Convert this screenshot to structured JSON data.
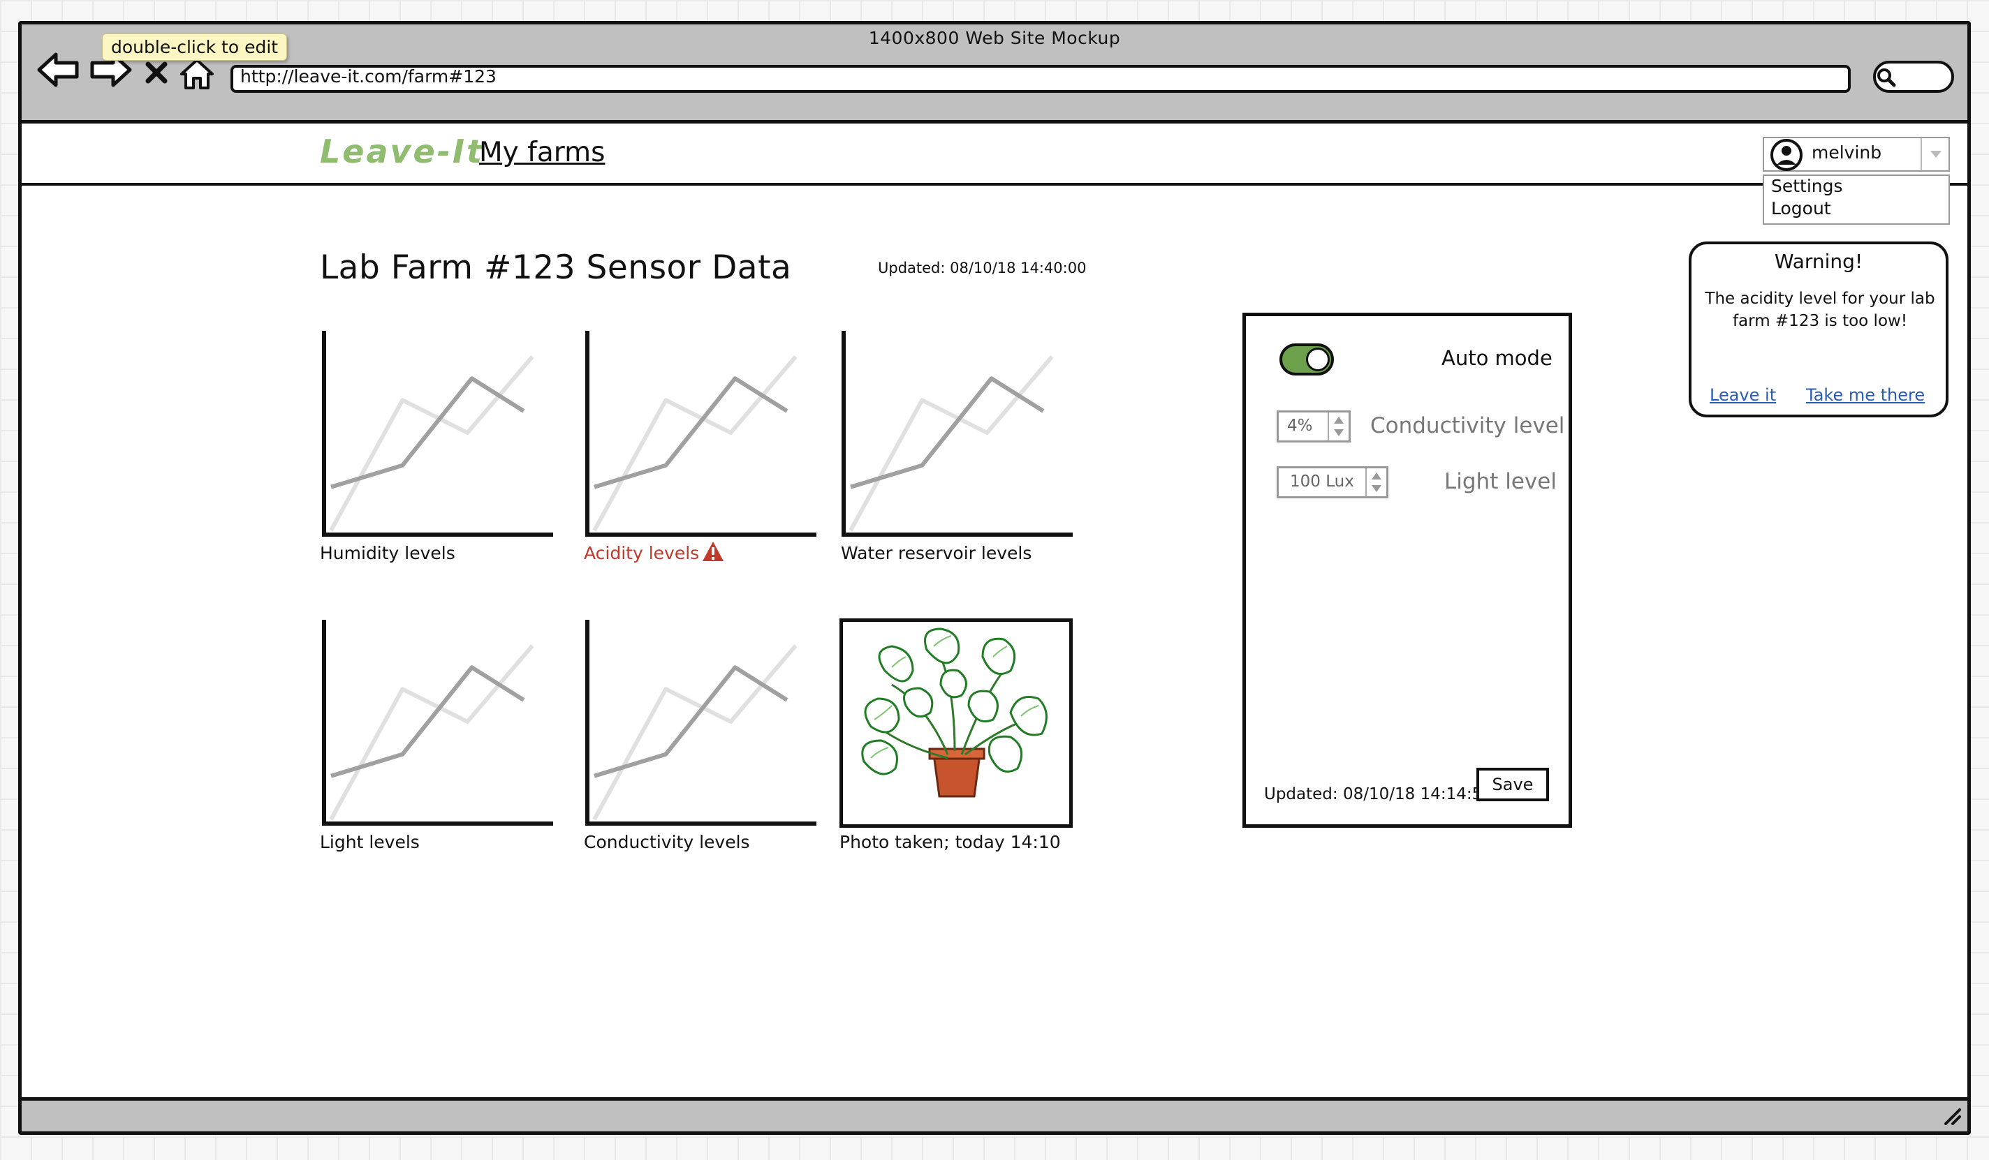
{
  "browser": {
    "title": "1400x800 Web Site Mockup",
    "url": "http://leave-it.com/farm#123",
    "tooltip": "double-click to edit"
  },
  "header": {
    "brand": "Leave-It",
    "nav_link": "My farms",
    "user": {
      "name": "melvinb",
      "menu": [
        "Settings",
        "Logout"
      ]
    }
  },
  "main": {
    "title": "Lab Farm #123 Sensor Data",
    "updated": "Updated: 08/10/18 14:40:00",
    "charts": [
      {
        "label": "Humidity levels",
        "alert": false
      },
      {
        "label": "Acidity levels",
        "alert": true
      },
      {
        "label": "Water reservoir levels",
        "alert": false
      },
      {
        "label": "Light levels",
        "alert": false
      },
      {
        "label": "Conductivity levels",
        "alert": false
      }
    ],
    "photo": {
      "label": "Photo taken; today 14:10"
    }
  },
  "controls": {
    "auto_mode_label": "Auto mode",
    "auto_mode_on": true,
    "conductivity": {
      "value": "4%",
      "label": "Conductivity level"
    },
    "light": {
      "value": "100 Lux",
      "label": "Light level"
    },
    "updated": "Updated: 08/10/18 14:14:59",
    "save_label": "Save"
  },
  "warning": {
    "title": "Warning!",
    "message": "The acidity level for your lab farm #123 is too low!",
    "leave_label": "Leave it",
    "take_label": "Take me there"
  },
  "colors": {
    "brand": "#8fbc6f",
    "alert": "#c0392b",
    "toggle_on": "#6da04b",
    "link": "#2a5db0"
  },
  "chart_data": {
    "type": "line",
    "note_free": true,
    "series": [
      {
        "values": [
          2,
          3,
          7,
          5.5
        ]
      },
      {
        "values": [
          0,
          6,
          4.5,
          8
        ]
      }
    ]
  }
}
